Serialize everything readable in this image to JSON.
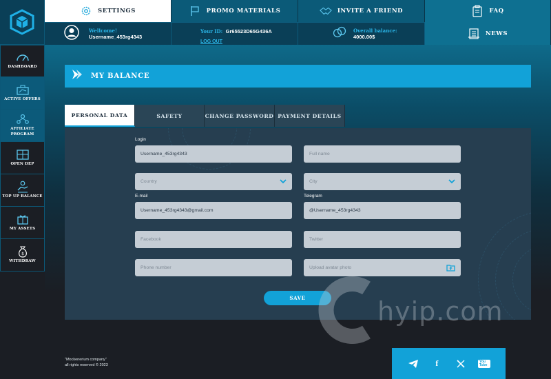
{
  "topnav": {
    "settings": "SETTINGS",
    "promo": "PROMO MATERIALS",
    "invite": "INVITE A FRIEND",
    "faq": "FAQ",
    "news": "NEWS"
  },
  "user": {
    "welcome_label": "Wellcome!",
    "username": "Username_453rg4343",
    "id_label": "Your ID:",
    "id_value": "Gr65523D65G436A",
    "logout": "LOG OUT",
    "balance_label": "Overall balance:",
    "balance_value": "4000.00$"
  },
  "sidebar": {
    "items": [
      {
        "label": "DASHBOARD"
      },
      {
        "label": "ACTIVE OFFERS"
      },
      {
        "label": "AFFILIATE PROGRAM"
      },
      {
        "label": "OPEN DEP"
      },
      {
        "label": "TOP UP BALANCE"
      },
      {
        "label": "MY ASSETS"
      },
      {
        "label": "WITHDRAW"
      }
    ]
  },
  "page": {
    "title": "MY BALANCE"
  },
  "tabs": [
    {
      "label": "PERSONAL DATA"
    },
    {
      "label": "SAFETY"
    },
    {
      "label": "CHANGE PASSWORD"
    },
    {
      "label": "PAYMENT DETAILS"
    }
  ],
  "form": {
    "login_label": "Login",
    "login_value": "Username_453rg4343",
    "fullname_placeholder": "Full name",
    "country_placeholder": "Country",
    "city_placeholder": "City",
    "email_label": "E-mail",
    "email_value": "Username_453rg4343@gmail.com",
    "telegram_label": "Telegram",
    "telegram_value": "@Username_453rg4343",
    "facebook_placeholder": "Facebook",
    "twitter_placeholder": "Twitter",
    "phone_placeholder": "Phone number",
    "avatar_placeholder": "Upload avatar photo",
    "save": "SAVE"
  },
  "watermark": {
    "text": "hyip.com"
  },
  "footer": {
    "company": "\"Mockenerium company\"",
    "rights": "all rights reserved © 2023"
  },
  "colors": {
    "accent": "#12a2d8",
    "dark": "#1b1e24",
    "panel": "#263e50"
  },
  "icons": {
    "telegram": "telegram-icon",
    "facebook": "facebook-icon",
    "x": "x-icon",
    "youtube": "youtube-icon"
  },
  "social": {
    "facebook": "f",
    "youtube": "You Tube"
  }
}
